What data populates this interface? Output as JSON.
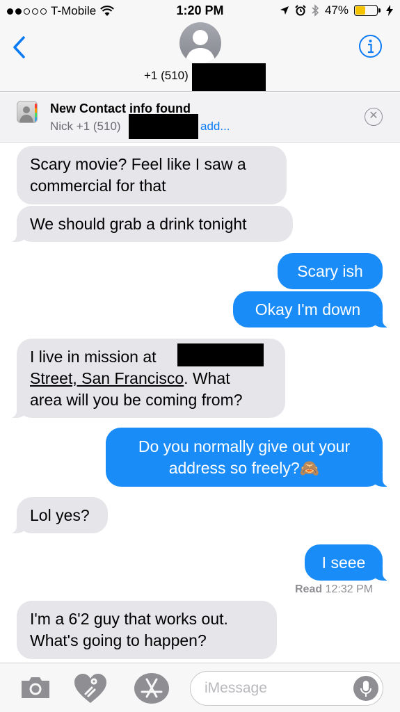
{
  "status_bar": {
    "carrier": "T-Mobile",
    "time": "1:20 PM",
    "battery_percent": "47%",
    "battery_level": 0.47,
    "signal_bars_filled": 2,
    "signal_bars_total": 5
  },
  "header": {
    "contact_number": "+1 (510)",
    "back_icon": "chevron-left-icon",
    "info_icon": "info-icon",
    "accent_color": "#0a7af5"
  },
  "banner": {
    "title": "New Contact info found",
    "subtitle": "Nick +1 (510)",
    "add_label": "add...",
    "close_icon": "close-icon"
  },
  "messages": [
    {
      "direction": "incoming",
      "lines": [
        "Scary movie? Feel like I saw a",
        "commercial for that"
      ]
    },
    {
      "direction": "incoming",
      "lines": [
        "We should grab a drink tonight"
      ]
    },
    {
      "direction": "outgoing",
      "lines": [
        "Scary ish"
      ]
    },
    {
      "direction": "outgoing",
      "lines": [
        "Okay I'm down"
      ]
    },
    {
      "direction": "incoming",
      "lines": [
        "I live in mission at",
        "Street, San Francisco. What",
        "area will you be coming from?"
      ],
      "link_text": "Street, San Francisco",
      "link_rest": ". What"
    },
    {
      "direction": "outgoing",
      "lines": [
        "Do you normally give out your",
        "address so freely?🙈"
      ]
    },
    {
      "direction": "incoming",
      "lines": [
        "Lol yes?"
      ]
    },
    {
      "direction": "outgoing",
      "lines": [
        "I seee"
      ]
    },
    {
      "direction": "incoming",
      "lines": [
        "I'm a 6'2 guy that works out.",
        "What's going to happen?"
      ]
    }
  ],
  "read_receipt": {
    "label": "Read",
    "time": "12:32 PM"
  },
  "input_bar": {
    "placeholder": "iMessage",
    "camera_icon": "camera-icon",
    "digital_touch_icon": "digital-touch-heart-icon",
    "app_store_icon": "app-store-icon",
    "mic_icon": "microphone-icon"
  },
  "colors": {
    "outgoing_bubble": "#1a8cf7",
    "incoming_bubble": "#e5e5ea",
    "battery": "#f5c400"
  }
}
